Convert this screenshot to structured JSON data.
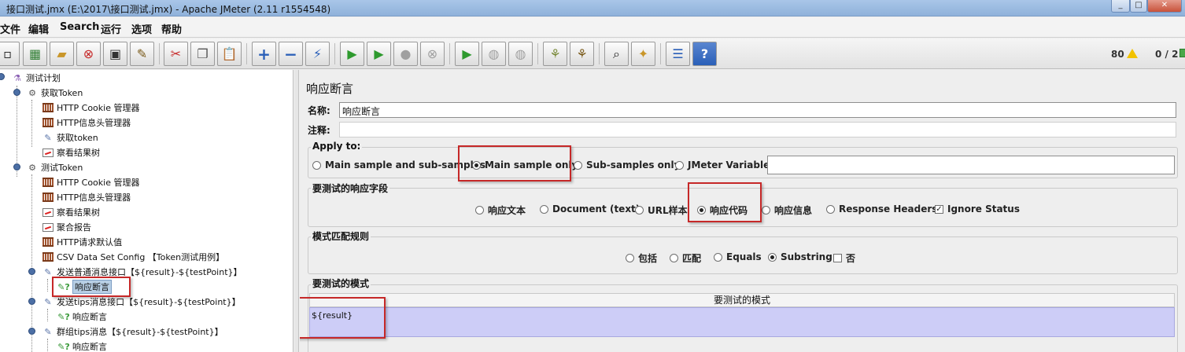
{
  "window": {
    "title": "接口测试.jmx (E:\\2017\\接口测试.jmx) - Apache JMeter (2.11 r1554548)"
  },
  "menu": [
    "文件",
    "编辑",
    "Search",
    "运行",
    "选项",
    "帮助"
  ],
  "toolbar": {
    "warning_count": "80",
    "thread_count": "0 / 2"
  },
  "tree": {
    "nodes": [
      {
        "label": "测试计划",
        "icon": "flask-icon"
      },
      {
        "label": "获取Token",
        "icon": "thread-group-icon"
      },
      {
        "label": "HTTP Cookie 管理器",
        "icon": "config-element-icon"
      },
      {
        "label": "HTTP信息头管理器",
        "icon": "config-element-icon"
      },
      {
        "label": "获取token",
        "icon": "sampler-icon"
      },
      {
        "label": "察看结果树",
        "icon": "listener-icon"
      },
      {
        "label": "测试Token",
        "icon": "thread-group-icon"
      },
      {
        "label": "HTTP Cookie 管理器",
        "icon": "config-element-icon"
      },
      {
        "label": "HTTP信息头管理器",
        "icon": "config-element-icon"
      },
      {
        "label": "察看结果树",
        "icon": "listener-icon"
      },
      {
        "label": "聚合报告",
        "icon": "listener-icon"
      },
      {
        "label": "HTTP请求默认值",
        "icon": "config-element-icon"
      },
      {
        "label": "CSV Data Set Config 【Token测试用例】",
        "icon": "config-element-icon"
      },
      {
        "label": "发送普通消息接口【${result}-${testPoint}】",
        "icon": "sampler-icon"
      },
      {
        "label": "响应断言",
        "icon": "assertion-icon"
      },
      {
        "label": "发送tips消息接口【${result}-${testPoint}】",
        "icon": "sampler-icon"
      },
      {
        "label": "响应断言",
        "icon": "assertion-icon"
      },
      {
        "label": "群组tips消息【${result}-${testPoint}】",
        "icon": "sampler-icon"
      },
      {
        "label": "响应断言",
        "icon": "assertion-icon"
      }
    ]
  },
  "panel": {
    "title": "响应断言",
    "name_label": "名称:",
    "name_value": "响应断言",
    "comment_label": "注释:",
    "apply_to": {
      "title": "Apply to:",
      "options": [
        "Main sample and sub-samples",
        "Main sample only",
        "Sub-samples only",
        "JMeter Variable"
      ],
      "selected": "Main sample only"
    },
    "response_field": {
      "title": "要测试的响应字段",
      "options": [
        "响应文本",
        "Document (text)",
        "URL样本",
        "响应代码",
        "响应信息",
        "Response Headers"
      ],
      "selected": "响应代码",
      "ignore_status_label": "Ignore Status",
      "ignore_status_checked": true
    },
    "pattern_rule": {
      "title": "模式匹配规则",
      "options": [
        "包括",
        "匹配",
        "Equals",
        "Substring"
      ],
      "selected": "Substring",
      "not_label": "否"
    },
    "patterns": {
      "title": "要测试的模式",
      "column_header": "要测试的模式",
      "rows": [
        "${result}"
      ]
    }
  },
  "colors": {
    "highlight_box": "#c62828",
    "selection": "#cdcdf7"
  }
}
